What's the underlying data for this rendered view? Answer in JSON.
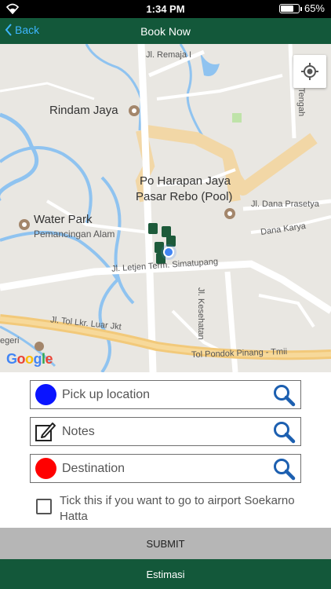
{
  "status_bar": {
    "time": "1:34 PM",
    "battery": "65%",
    "battery_level": 0.65
  },
  "navbar": {
    "back_label": "Back",
    "title": "Book Now"
  },
  "map": {
    "labels": {
      "remaja": "Jl. Remaja I",
      "rindam": "Rindam Jaya",
      "po_harapan_1": "Po Harapan Jaya",
      "po_harapan_2": "Pasar Rebo (Pool)",
      "water_park": "Water Park",
      "pemancingan": "Pemancingan Alam",
      "dana_prasetya": "Jl. Dana Prasetya",
      "dana_karya": "Dana Karya",
      "letjen": "Jl. Letjen Term. Simatupang",
      "kesehatan": "Jl. Kesehatan",
      "tengah": "Tengah",
      "tol_lkr": "Jl. Tol Lkr. Luar Jkt",
      "tol_pondok": "Tol Pondok Pinang - Tmii",
      "negeri": "egeri"
    },
    "google_logo": "Google",
    "locate_icon": "my-location-icon"
  },
  "form": {
    "pickup": {
      "placeholder": "Pick up location",
      "dot_color": "#0a14ff"
    },
    "notes": {
      "placeholder": "Notes"
    },
    "destination": {
      "placeholder": "Destination",
      "dot_color": "#ff0000"
    },
    "airport_checkbox": {
      "label": "Tick this if you want to go to airport Soekarno Hatta",
      "checked": false
    }
  },
  "buttons": {
    "submit": "SUBMIT",
    "estimasi": "Estimasi"
  },
  "colors": {
    "header_green": "#13583a",
    "back_blue": "#3db6ff",
    "search_icon_blue": "#1c5fb0"
  }
}
